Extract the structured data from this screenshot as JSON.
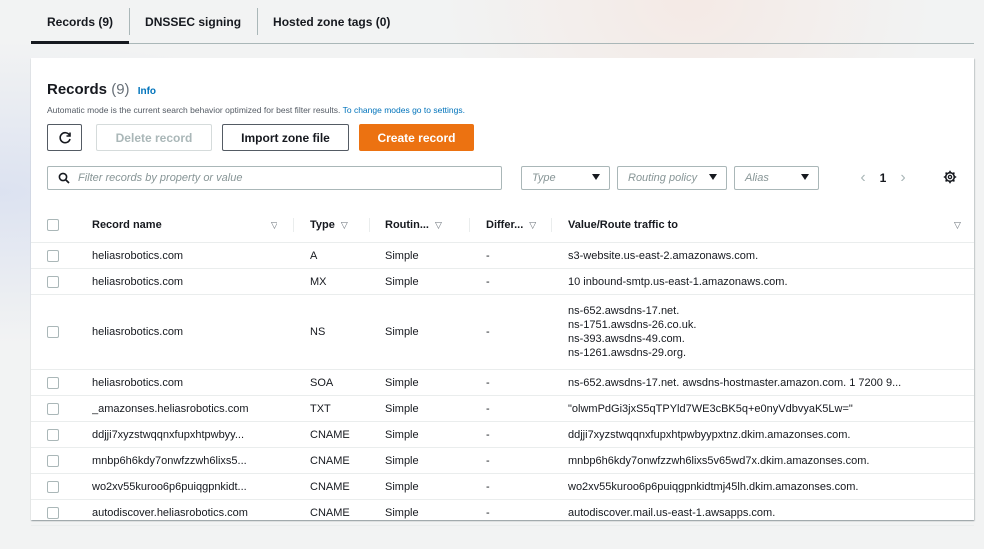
{
  "tabs": [
    {
      "label": "Records (9)",
      "active": true
    },
    {
      "label": "DNSSEC signing",
      "active": false
    },
    {
      "label": "Hosted zone tags (0)",
      "active": false
    }
  ],
  "header": {
    "title": "Records",
    "count": "(9)",
    "info": "Info",
    "description": "Automatic mode is the current search behavior optimized for best filter results.",
    "description_link": "To change modes go to settings."
  },
  "actions": {
    "refresh_icon": "refresh-icon",
    "delete": "Delete record",
    "import": "Import zone file",
    "create": "Create record"
  },
  "filters": {
    "search_placeholder": "Filter records by property or value",
    "type": "Type",
    "routing": "Routing policy",
    "alias": "Alias"
  },
  "pagination": {
    "page": "1"
  },
  "table": {
    "columns": [
      "Record name",
      "Type",
      "Routin...",
      "Differ...",
      "Value/Route traffic to"
    ],
    "rows": [
      {
        "name": "heliasrobotics.com",
        "type": "A",
        "routing": "Simple",
        "diff": "-",
        "value": [
          "s3-website.us-east-2.amazonaws.com."
        ]
      },
      {
        "name": "heliasrobotics.com",
        "type": "MX",
        "routing": "Simple",
        "diff": "-",
        "value": [
          "10 inbound-smtp.us-east-1.amazonaws.com."
        ]
      },
      {
        "name": "heliasrobotics.com",
        "type": "NS",
        "routing": "Simple",
        "diff": "-",
        "value": [
          "ns-652.awsdns-17.net.",
          "ns-1751.awsdns-26.co.uk.",
          "ns-393.awsdns-49.com.",
          "ns-1261.awsdns-29.org."
        ]
      },
      {
        "name": "heliasrobotics.com",
        "type": "SOA",
        "routing": "Simple",
        "diff": "-",
        "value": [
          "ns-652.awsdns-17.net. awsdns-hostmaster.amazon.com. 1 7200 9..."
        ]
      },
      {
        "name": "_amazonses.heliasrobotics.com",
        "type": "TXT",
        "routing": "Simple",
        "diff": "-",
        "value": [
          "\"olwmPdGi3jxS5qTPYld7WE3cBK5q+e0nyVdbvyaK5Lw=\""
        ]
      },
      {
        "name": "ddjji7xyzstwqqnxfupxhtpwbyy...",
        "type": "CNAME",
        "routing": "Simple",
        "diff": "-",
        "value": [
          "ddjji7xyzstwqqnxfupxhtpwbyypxtnz.dkim.amazonses.com."
        ]
      },
      {
        "name": "mnbp6h6kdy7onwfzzwh6lixs5...",
        "type": "CNAME",
        "routing": "Simple",
        "diff": "-",
        "value": [
          "mnbp6h6kdy7onwfzzwh6lixs5v65wd7x.dkim.amazonses.com."
        ]
      },
      {
        "name": "wo2xv55kuroo6p6puiqgpnkidt...",
        "type": "CNAME",
        "routing": "Simple",
        "diff": "-",
        "value": [
          "wo2xv55kuroo6p6puiqgpnkidtmj45lh.dkim.amazonses.com."
        ]
      },
      {
        "name": "autodiscover.heliasrobotics.com",
        "type": "CNAME",
        "routing": "Simple",
        "diff": "-",
        "value": [
          "autodiscover.mail.us-east-1.awsapps.com."
        ]
      }
    ]
  }
}
